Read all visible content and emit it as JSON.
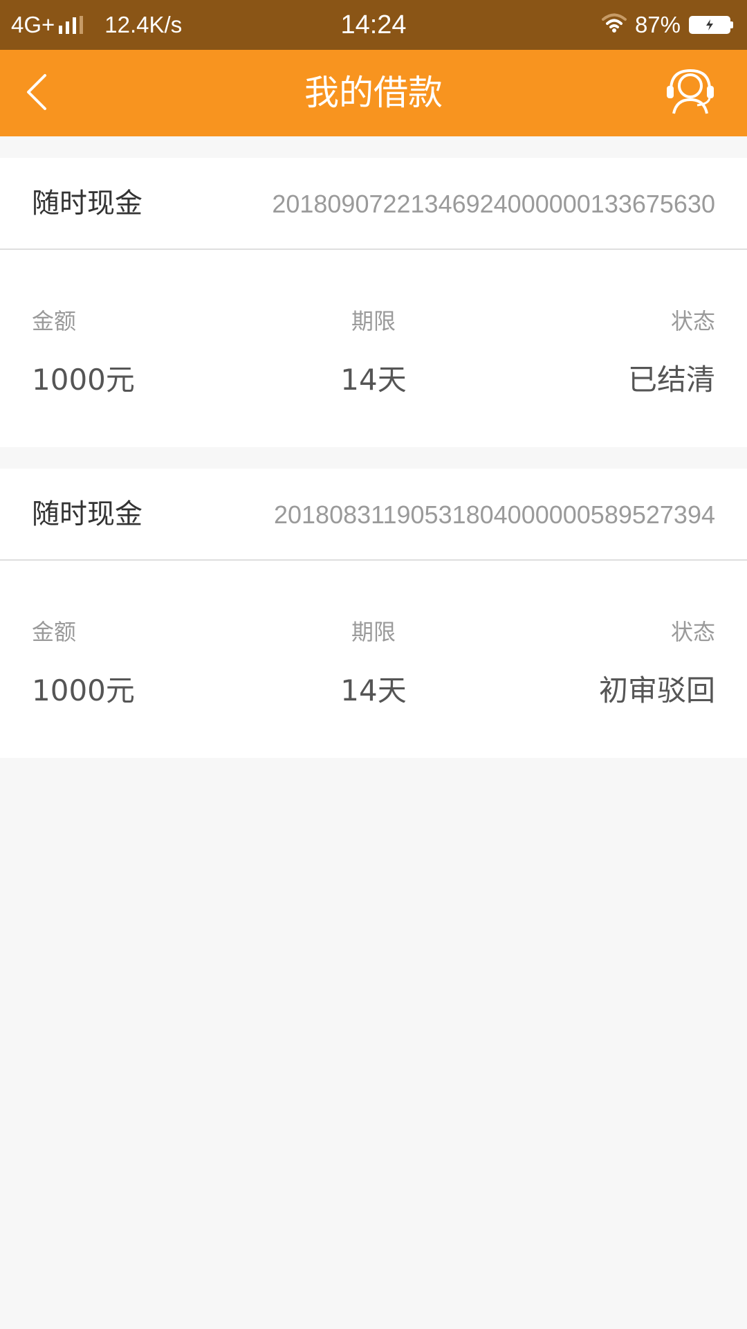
{
  "status_bar": {
    "network": "4G+",
    "speed": "12.4K/s",
    "time": "14:24",
    "battery": "87%"
  },
  "header": {
    "title": "我的借款",
    "back_icon": "chevron-left-icon",
    "service_icon": "customer-service-headset-icon"
  },
  "loans": [
    {
      "product": "随时现金",
      "order_no": "20180907221346924000000133675630",
      "amount_label": "金额",
      "amount": "1000元",
      "term_label": "期限",
      "term": "14天",
      "status_label": "状态",
      "status": "已结清"
    },
    {
      "product": "随时现金",
      "order_no": "20180831190531804000000589527394",
      "amount_label": "金额",
      "amount": "1000元",
      "term_label": "期限",
      "term": "14天",
      "status_label": "状态",
      "status": "初审驳回"
    }
  ],
  "colors": {
    "status_bar_bg": "#8a5516",
    "header_bg": "#f8941f",
    "page_bg": "#f7f7f7"
  }
}
